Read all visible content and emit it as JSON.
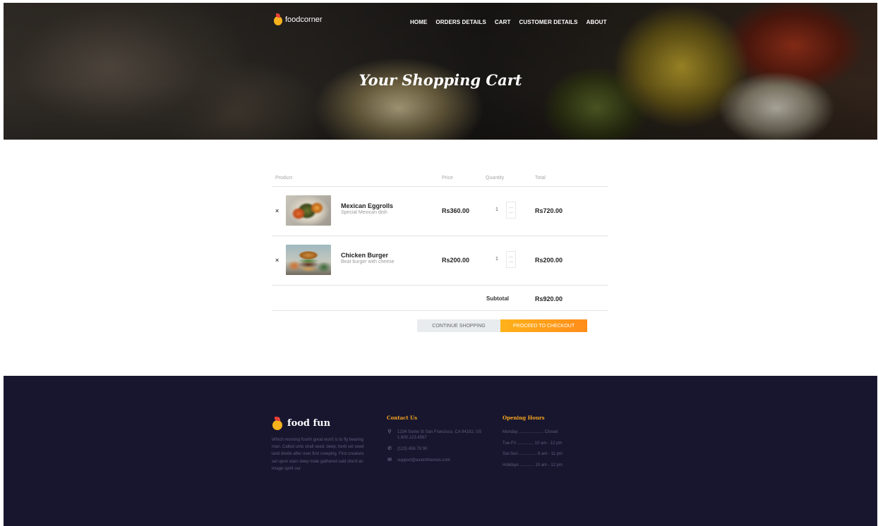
{
  "header": {
    "logo_text": "foodcorner",
    "nav": [
      "HOME",
      "ORDERS DETAILS",
      "CART",
      "CUSTOMER DETAILS",
      "ABOUT"
    ],
    "hero_title": "Your Shopping Cart"
  },
  "cart": {
    "columns": {
      "product": "Product",
      "price": "Price",
      "quantity": "Quantity",
      "total": "Total"
    },
    "remove_symbol": "×",
    "items": [
      {
        "name": "Mexican Eggrolls",
        "description": "Special Mexican dish",
        "price": "Rs360.00",
        "quantity": "1",
        "total": "Rs720.00",
        "image": "eggroll-photo"
      },
      {
        "name": "Chicken Burger",
        "description": "Beat burger with cheese",
        "price": "Rs200.00",
        "quantity": "1",
        "total": "Rs200.00",
        "image": "burger-photo"
      }
    ],
    "subtotal_label": "Subtotal",
    "subtotal_value": "Rs920.00",
    "continue_label": "CONTINUE SHOPPING",
    "checkout_label": "PROCEED TO CHECKOUT"
  },
  "footer": {
    "logo_text": "food fun",
    "about": "Which morning fourth great won't is to fly bearing man. Called unto shall seed, deep, herb set seed land divide after over first creeping. First creature set upon stars deep male gathered said she'd an image spirit our",
    "contact_heading": "Contact Us",
    "contact": [
      {
        "icon": "map-pin-icon",
        "text": "1234 Some St San Francisco, CA 94102, US 1.800.123.4567"
      },
      {
        "icon": "phone-icon",
        "text": "(123) 456 78 90"
      },
      {
        "icon": "envelope-icon",
        "text": "support@axiomthemes.com"
      }
    ],
    "hours_heading": "Opening Hours",
    "hours": [
      "Monday ..................... Closed",
      "Tue-Fri .............. 10 am - 12 pm",
      "Sat-Sun ............... 8 am - 11 pm",
      "Holidays ............ 10 am - 12 pm"
    ]
  },
  "colors": {
    "accent": "#ff9c1a",
    "footer_bg": "#18162f",
    "footer_heading": "#f6a51e"
  }
}
